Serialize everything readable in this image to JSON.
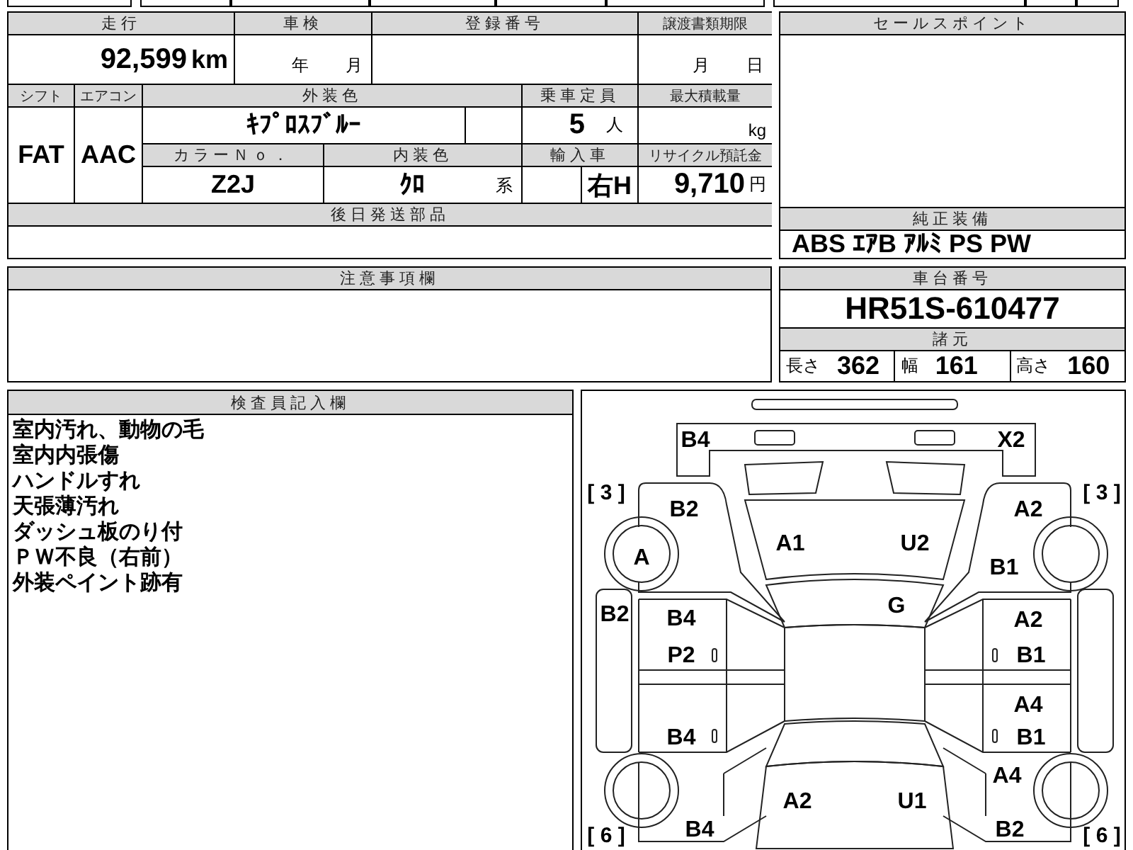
{
  "odometer": {
    "label": "走行",
    "value": "92,599",
    "unit": "km"
  },
  "inspection": {
    "label": "車検",
    "year_unit": "年",
    "month_unit": "月"
  },
  "registration_number": {
    "label": "登録番号"
  },
  "transfer_deadline": {
    "label": "譲渡書類期限",
    "month_unit": "月",
    "day_unit": "日"
  },
  "shift": {
    "label": "シフト",
    "value": "FAT"
  },
  "air_conditioner": {
    "label": "エアコン",
    "value": "AAC"
  },
  "exterior_color": {
    "label": "外装色",
    "value": "ｷﾌﾟﾛｽﾌﾞﾙｰ"
  },
  "capacity": {
    "label": "乗車定員",
    "value": "5",
    "unit": "人"
  },
  "max_load": {
    "label": "最大積載量",
    "unit": "kg"
  },
  "color_number": {
    "label": "カラーＮｏ．",
    "value": "Z2J"
  },
  "interior_color": {
    "label": "内装色",
    "value": "ｸﾛ",
    "suffix": "系"
  },
  "import_car": {
    "label": "輸入車",
    "value": "右H"
  },
  "recycle_deposit": {
    "label": "リサイクル預託金",
    "value": "9,710",
    "unit": "円"
  },
  "later_parts": {
    "label": "後日発送部品"
  },
  "cautions": {
    "label": "注意事項欄"
  },
  "sales_points": {
    "label": "セールスポイント"
  },
  "standard_equipment": {
    "label": "純正装備",
    "value": "ABS ｴｱB ｱﾙﾐ PS PW"
  },
  "chassis_number": {
    "label": "車台番号",
    "value": "HR51S-610477"
  },
  "specs": {
    "label": "諸元",
    "items": [
      {
        "label": "長さ",
        "value": "362"
      },
      {
        "label": "幅",
        "value": "161"
      },
      {
        "label": "高さ",
        "value": "160"
      }
    ]
  },
  "inspector_notes": {
    "label": "検査員記入欄",
    "lines": [
      "室内汚れ、動物の毛",
      "室内内張傷",
      "ハンドルすれ",
      "天張薄汚れ",
      "ダッシュ板のり付",
      "ＰＷ不良（右前）",
      "外装ペイント跡有"
    ]
  },
  "damage_map": {
    "marks": [
      {
        "kind": "code",
        "text": "B4"
      },
      {
        "kind": "code",
        "text": "X2"
      },
      {
        "kind": "section",
        "text": "[ 3 ]"
      },
      {
        "kind": "code",
        "text": "B2"
      },
      {
        "kind": "code",
        "text": "A2"
      },
      {
        "kind": "section",
        "text": "[ 3 ]"
      },
      {
        "kind": "code",
        "text": "A"
      },
      {
        "kind": "code",
        "text": "A1"
      },
      {
        "kind": "code",
        "text": "U2"
      },
      {
        "kind": "code",
        "text": "B1"
      },
      {
        "kind": "code",
        "text": "B2"
      },
      {
        "kind": "code",
        "text": "B4"
      },
      {
        "kind": "code",
        "text": "G"
      },
      {
        "kind": "code",
        "text": "A2"
      },
      {
        "kind": "code",
        "text": "P2"
      },
      {
        "kind": "code",
        "text": "B1"
      },
      {
        "kind": "code",
        "text": "A4"
      },
      {
        "kind": "code",
        "text": "B4"
      },
      {
        "kind": "code",
        "text": "B1"
      },
      {
        "kind": "code",
        "text": "A4"
      },
      {
        "kind": "code",
        "text": "A2"
      },
      {
        "kind": "code",
        "text": "U1"
      },
      {
        "kind": "section",
        "text": "[ 6 ]"
      },
      {
        "kind": "code",
        "text": "B4"
      },
      {
        "kind": "code",
        "text": "B2"
      },
      {
        "kind": "section",
        "text": "[ 6 ]"
      }
    ]
  }
}
